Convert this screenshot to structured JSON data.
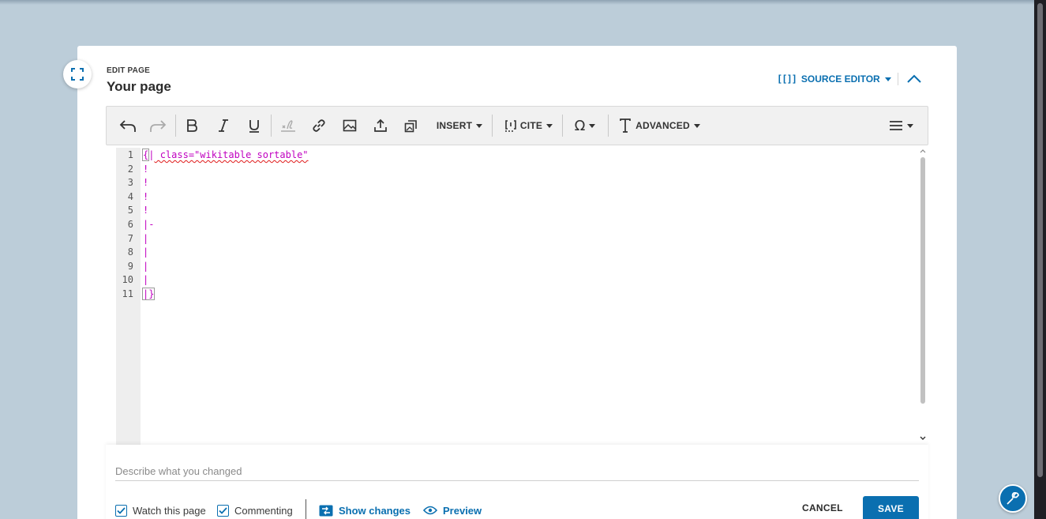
{
  "header": {
    "edit_label": "EDIT PAGE",
    "page_title": "Your page",
    "source_editor_label": "SOURCE EDITOR",
    "source_editor_icon": "[[]]"
  },
  "toolbar": {
    "insert_label": "INSERT",
    "cite_label": "CITE",
    "advanced_label": "ADVANCED",
    "icons": [
      "undo-icon",
      "redo-icon",
      "bold-icon",
      "italic-icon",
      "underline-icon",
      "signature-icon",
      "link-icon",
      "image-icon",
      "upload-icon",
      "gallery-icon",
      "cite-icon",
      "omega-icon",
      "text-format-icon",
      "menu-icon"
    ]
  },
  "editor": {
    "line_numbers": [
      "1",
      "2",
      "3",
      "4",
      "5",
      "6",
      "7",
      "8",
      "9",
      "10",
      "11"
    ],
    "lines": [
      "{| class=\"wikitable sortable\"",
      "!",
      "!",
      "!",
      "!",
      "|-",
      "|",
      "|",
      "|",
      "|",
      "|}"
    ]
  },
  "footer": {
    "summary_placeholder": "Describe what you changed",
    "summary_value": "",
    "watch_label": "Watch this page",
    "watch_checked": true,
    "commenting_label": "Commenting",
    "commenting_checked": true,
    "show_changes_label": "Show changes",
    "preview_label": "Preview",
    "cancel_label": "CANCEL",
    "save_label": "SAVE"
  },
  "colors": {
    "accent": "#0a6fb0",
    "background": "#bccdd9",
    "syntax": "#c000c0",
    "spellcheck": "#e01a1a"
  }
}
